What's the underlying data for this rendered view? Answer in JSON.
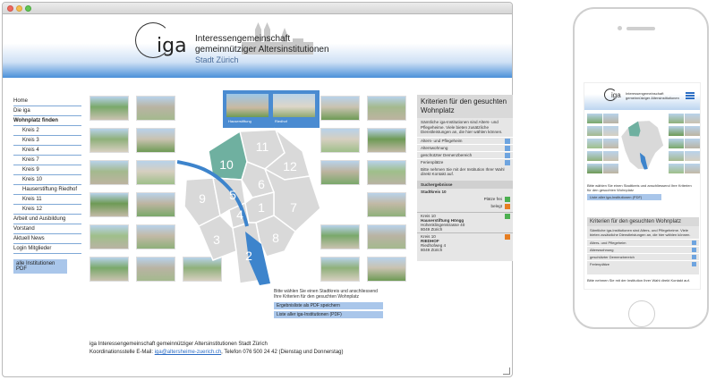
{
  "header": {
    "logo_text": "iga",
    "org_line1": "Interessengemeinschaft",
    "org_line2": "gemeinnütziger Altersinstitutionen",
    "org_line3": "Stadt Zürich"
  },
  "nav": {
    "items": [
      {
        "label": "Home",
        "sub": false,
        "bold": false
      },
      {
        "label": "Die iga",
        "sub": false,
        "bold": false
      },
      {
        "label": "Wohnplatz finden",
        "sub": false,
        "bold": true
      },
      {
        "label": "Kreis 2",
        "sub": true,
        "bold": false
      },
      {
        "label": "Kreis 3",
        "sub": true,
        "bold": false
      },
      {
        "label": "Kreis 4",
        "sub": true,
        "bold": false
      },
      {
        "label": "Kreis 7",
        "sub": true,
        "bold": false
      },
      {
        "label": "Kreis 9",
        "sub": true,
        "bold": false
      },
      {
        "label": "Kreis 10",
        "sub": true,
        "bold": false
      },
      {
        "label": "Hauserstiftung Riedhof",
        "sub": true,
        "bold": false
      },
      {
        "label": "Kreis 11",
        "sub": true,
        "bold": false
      },
      {
        "label": "Kreis 12",
        "sub": true,
        "bold": false
      },
      {
        "label": "Arbeit und Ausbildung",
        "sub": false,
        "bold": false
      },
      {
        "label": "Vorstand",
        "sub": false,
        "bold": false
      },
      {
        "label": "Aktuell News",
        "sub": false,
        "bold": false
      },
      {
        "label": "Login Mitglieder",
        "sub": false,
        "bold": false
      }
    ],
    "pdf_button": "alle Institutionen PDF"
  },
  "selection": {
    "left_label": "Hauserstiftung",
    "right_label": "Riedhof"
  },
  "map": {
    "districts": [
      "11",
      "12",
      "10",
      "6",
      "9",
      "5",
      "7",
      "4",
      "1",
      "3",
      "8",
      "2"
    ],
    "selected": "10"
  },
  "instructions": "Bitte wählen Sie einen Stadtkreis und anschliessend Ihre Kriterien für den gesuchten Wohnplatz",
  "buttons": {
    "save_pdf": "Ergebnisliste als PDF speichern",
    "list_pdf": "Liste aller iga-Institutionen (PDF)"
  },
  "criteria": {
    "title": "Kriterien für den gesuchten Wohnplatz",
    "intro": "Sämtliche iga-Institutionen sind Alters- und Pflegeheime. Viele bieten zusätzliche Dienstleistungen an, die hier wählen können.",
    "options": [
      "Alters- und Pflegeheim",
      "Alterswohnung",
      "geschützter Demenzbereich",
      "Ferienplätze"
    ],
    "contact_text": "Bitte nehmen Sie mit der Institution Ihrer Wahl direkt Kontakt auf.",
    "results_head": "Suchergebnisse",
    "results_sub": "Stadtkreis 10",
    "legend1": "Plätze frei",
    "legend2": "belegt",
    "result1_title": "Kreis 10",
    "result1_name": "Hauserstiftung Höngg",
    "result1_addr": "Hohenklingenstrasse 40",
    "result1_city": "8049 Zürich",
    "result2_title": "Kreis 10",
    "result2_name": "RIEDHOF",
    "result2_addr": "Riedhofweg 4",
    "result2_city": "8049 Zürich",
    "colors": {
      "free": "#4caf50",
      "occupied": "#e67e22"
    }
  },
  "footer": {
    "line1": "iga Interessengemeinschaft gemeinnütziger Altersinstitutionen Stadt Zürich",
    "line2_pre": "Koordinationsstelle E-Mail: ",
    "email": "iga@altersheime-zuerich.ch",
    "line2_post": ", Telefon 076 500 24 42 (Dienstag und Donnerstag)"
  },
  "mobile": {
    "instructions": "Bitte wählen Sie einen Stadtkreis und anschliessend Ihre Kriterien für den gesuchten Wohnplatz",
    "list_btn": "Liste aller iga-Institutionen (PDF)",
    "criteria_title": "Kriterien für den gesuchten Wohnplatz",
    "criteria_intro": "Sämtliche iga-Institutionen sind Alters- und Pflegeheime. Viele bieten zusätzliche Dienstleistungen an, die hier wählen können.",
    "options": [
      "Alters- und Pflegeheim",
      "Alterswohnung",
      "geschützter Demenzbereich",
      "Ferienplätze"
    ],
    "contact_text": "Bitte nehmen Sie mit der Institution Ihrer Wahl direkt Kontakt auf."
  }
}
